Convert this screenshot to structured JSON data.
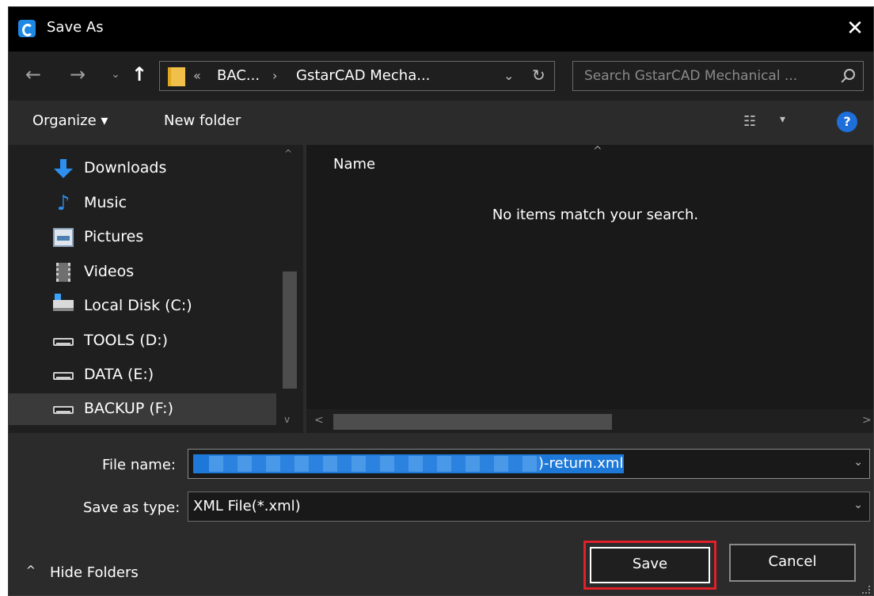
{
  "window": {
    "title": "Save As",
    "close_glyph": "✕",
    "accent_color": "#1e78d8",
    "highlight_color": "#e0202a"
  },
  "address": {
    "back_glyph": "←",
    "forward_glyph": "→",
    "recent_glyph": "⌄",
    "up_glyph": "↑",
    "breadcrumb_separator": "«",
    "breadcrumbs": [
      "BAC...",
      "GstarCAD Mecha..."
    ],
    "crumb_arrow": "›",
    "dropdown_glyph": "⌄",
    "refresh_glyph": "↻",
    "search_placeholder": "Search GstarCAD Mechanical ..."
  },
  "toolbar": {
    "organize_label": "Organize ▾",
    "new_folder_label": "New folder",
    "view_glyph": "☷",
    "view_arrow": "▾",
    "help_label": "?"
  },
  "nav": {
    "items": [
      {
        "label": "Downloads",
        "icon": "downloads-icon"
      },
      {
        "label": "Music",
        "icon": "music-icon",
        "glyph": "♪"
      },
      {
        "label": "Pictures",
        "icon": "pictures-icon"
      },
      {
        "label": "Videos",
        "icon": "videos-icon"
      },
      {
        "label": "Local Disk (C:)",
        "icon": "local-disk-icon"
      },
      {
        "label": "TOOLS (D:)",
        "icon": "drive-icon"
      },
      {
        "label": "DATA (E:)",
        "icon": "drive-icon"
      },
      {
        "label": "BACKUP (F:)",
        "icon": "drive-icon",
        "selected": true
      }
    ],
    "scroll_up": "^",
    "scroll_down": "v"
  },
  "filelist": {
    "sort_glyph": "^",
    "column_name": "Name",
    "empty_message": "No items match your search.",
    "scroll_left": "<",
    "scroll_right": ">"
  },
  "form": {
    "filename_label": "File name:",
    "filename_visible_suffix": ")-return.xml",
    "type_label": "Save as type:",
    "type_value": "XML File(*.xml)",
    "dropdown_glyph": "⌄"
  },
  "footer": {
    "hide_folders_glyph": "^",
    "hide_folders_label": "Hide Folders",
    "save_label": "Save",
    "cancel_label": "Cancel"
  }
}
